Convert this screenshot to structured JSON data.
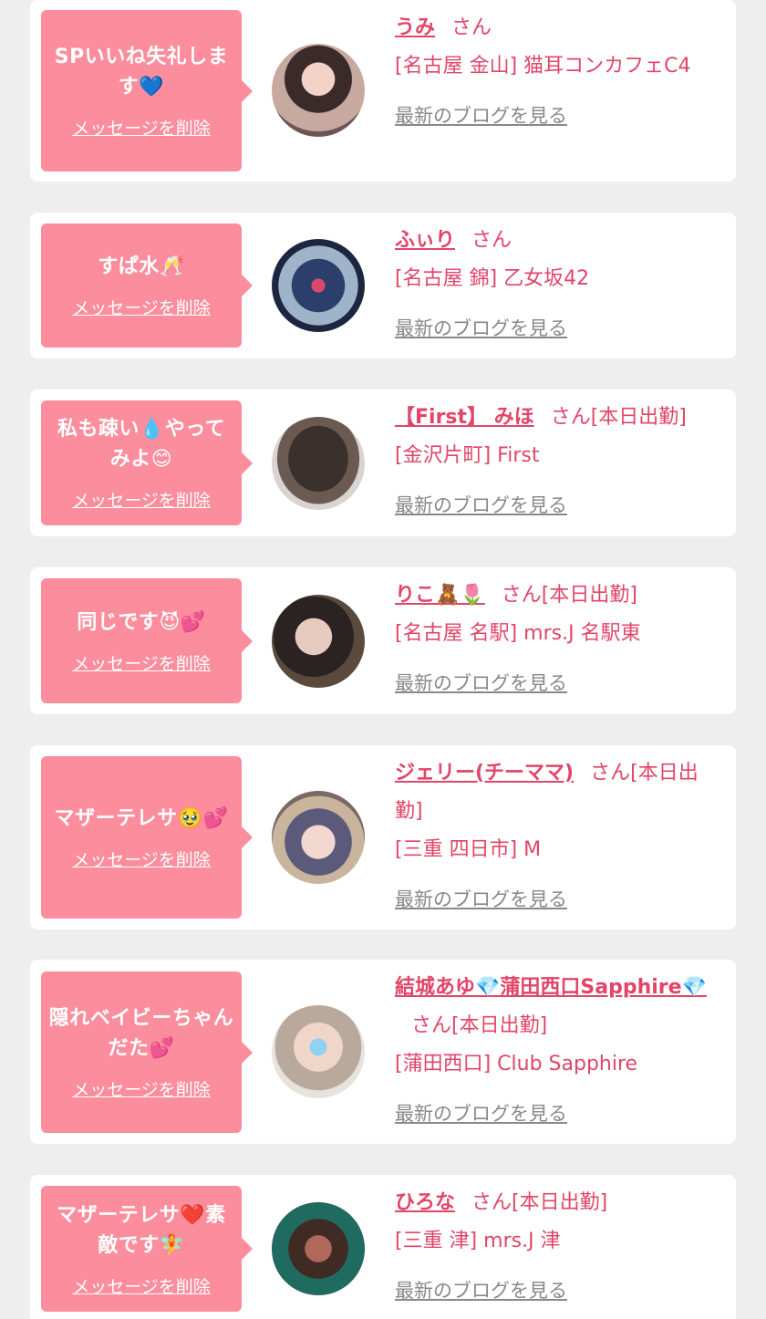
{
  "colors": {
    "background": "#efeeef",
    "card": "#ffffff",
    "bubble": "#fc8d9d",
    "accent": "#e24568",
    "link_gray": "#888888"
  },
  "delete_label": "メッセージを削除",
  "blog_label": "最新のブログを見る",
  "items": [
    {
      "message": "SPいいね失礼します💙",
      "name": "うみ",
      "suffix": "さん",
      "shop": "[名古屋 金山] 猫耳コンカフェC4"
    },
    {
      "message": "すぱ水🥂",
      "name": "ふぃり",
      "suffix": "さん",
      "shop": "[名古屋 錦] 乙女坂42"
    },
    {
      "message": "私も疎い💧やってみよ😊",
      "name": "【First】 みほ",
      "suffix": "さん[本日出勤]",
      "shop": "[金沢片町] First"
    },
    {
      "message": "同じです😈💕",
      "name": "りこ🧸🌷",
      "suffix": "さん[本日出勤]",
      "shop": "[名古屋 名駅] mrs.J 名駅東"
    },
    {
      "message": "マザーテレサ🥹💕",
      "name": "ジェリー(チーママ)",
      "suffix": "さん[本日出勤]",
      "shop": "[三重 四日市] M"
    },
    {
      "message": "隠れベイビーちゃんだた💕",
      "name": "結城あゆ💎蒲田西口Sapphire💎",
      "suffix": "さん[本日出勤]",
      "shop": "[蒲田西口] Club Sapphire"
    },
    {
      "message": "マザーテレサ❤️素敵です🧚",
      "name": "ひろな",
      "suffix": "さん[本日出勤]",
      "shop": "[三重 津] mrs.J 津"
    }
  ]
}
